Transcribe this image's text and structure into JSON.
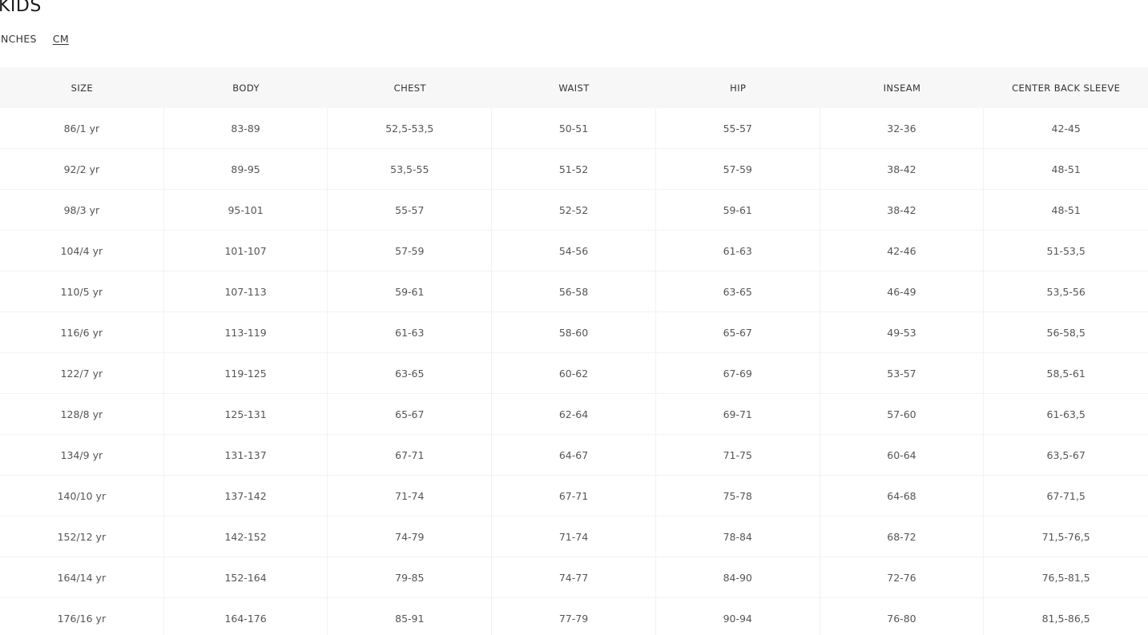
{
  "title": "KIDS",
  "units": {
    "inches": "INCHES",
    "cm": "CM",
    "selected": "CM"
  },
  "table": {
    "headers": [
      "SIZE",
      "BODY",
      "CHEST",
      "WAIST",
      "HIP",
      "INSEAM",
      "CENTER BACK SLEEVE"
    ],
    "rows": [
      [
        "86/1 yr",
        "83-89",
        "52,5-53,5",
        "50-51",
        "55-57",
        "32-36",
        "42-45"
      ],
      [
        "92/2 yr",
        "89-95",
        "53,5-55",
        "51-52",
        "57-59",
        "38-42",
        "48-51"
      ],
      [
        "98/3 yr",
        "95-101",
        "55-57",
        "52-52",
        "59-61",
        "38-42",
        "48-51"
      ],
      [
        "104/4 yr",
        "101-107",
        "57-59",
        "54-56",
        "61-63",
        "42-46",
        "51-53,5"
      ],
      [
        "110/5 yr",
        "107-113",
        "59-61",
        "56-58",
        "63-65",
        "46-49",
        "53,5-56"
      ],
      [
        "116/6 yr",
        "113-119",
        "61-63",
        "58-60",
        "65-67",
        "49-53",
        "56-58,5"
      ],
      [
        "122/7 yr",
        "119-125",
        "63-65",
        "60-62",
        "67-69",
        "53-57",
        "58,5-61"
      ],
      [
        "128/8 yr",
        "125-131",
        "65-67",
        "62-64",
        "69-71",
        "57-60",
        "61-63,5"
      ],
      [
        "134/9 yr",
        "131-137",
        "67-71",
        "64-67",
        "71-75",
        "60-64",
        "63,5-67"
      ],
      [
        "140/10 yr",
        "137-142",
        "71-74",
        "67-71",
        "75-78",
        "64-68",
        "67-71,5"
      ],
      [
        "152/12 yr",
        "142-152",
        "74-79",
        "71-74",
        "78-84",
        "68-72",
        "71,5-76,5"
      ],
      [
        "164/14 yr",
        "152-164",
        "79-85",
        "74-77",
        "84-90",
        "72-76",
        "76,5-81,5"
      ],
      [
        "176/16 yr",
        "164-176",
        "85-91",
        "77-79",
        "90-94",
        "76-80",
        "81,5-86,5"
      ]
    ]
  }
}
